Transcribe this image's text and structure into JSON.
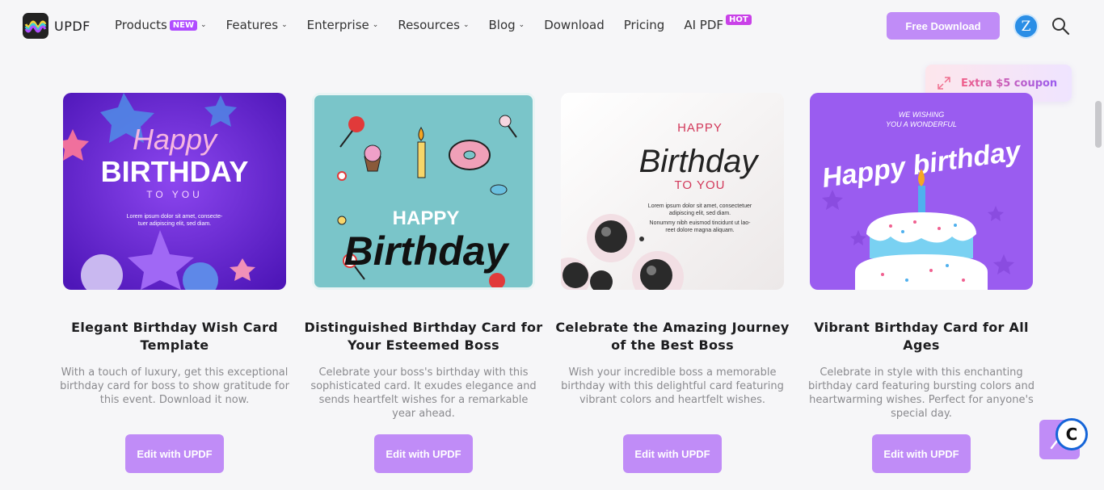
{
  "brand": {
    "name": "UPDF"
  },
  "nav": {
    "items": [
      {
        "label": "Products",
        "badge": "NEW",
        "dropdown": true
      },
      {
        "label": "Features",
        "dropdown": true
      },
      {
        "label": "Enterprise",
        "dropdown": true
      },
      {
        "label": "Resources",
        "dropdown": true
      },
      {
        "label": "Blog",
        "dropdown": true
      },
      {
        "label": "Download",
        "dropdown": false
      },
      {
        "label": "Pricing",
        "dropdown": false
      },
      {
        "label": "AI PDF",
        "badge": "HOT",
        "dropdown": false
      }
    ],
    "free_download": "Free Download",
    "avatar_initial": "Z"
  },
  "coupon": {
    "label": "Extra $5 coupon"
  },
  "cards": [
    {
      "title": "Elegant Birthday Wish Card Template",
      "description": "With a touch of luxury, get this exceptional birthday card for boss to show gratitude for this event. Download it now.",
      "button": "Edit with UPDF",
      "image_text": {
        "line1": "Happy",
        "line2": "BIRTHDAY",
        "line3": "TO YOU",
        "body1": "Lorem ipsum dolor sit amet, consecte-",
        "body2": "tuer adipiscing elit, sed diam."
      }
    },
    {
      "title": "Distinguished Birthday Card for Your Esteemed Boss",
      "description": "Celebrate your boss's birthday with this sophisticated card. It exudes elegance and sends heartfelt wishes for a remarkable year ahead.",
      "button": "Edit with UPDF",
      "image_text": {
        "line1": "HAPPY",
        "line2": "Birthday"
      }
    },
    {
      "title": "Celebrate the Amazing Journey of the Best Boss",
      "description": "Wish your incredible boss a memorable birthday with this delightful card featuring vibrant colors and heartfelt wishes.",
      "button": "Edit with UPDF",
      "image_text": {
        "line1": "HAPPY",
        "line2": "Birthday",
        "line3": "TO YOU",
        "body1": "Lorem ipsum dolor sit amet, consectetuer",
        "body2": "adipiscing elit, sed diam.",
        "body3": "Nonummy nibh euismod tincidunt ut lao-",
        "body4": "reet dolore magna aliquam."
      }
    },
    {
      "title": "Vibrant Birthday Card for All Ages",
      "description": "Celebrate in style with this enchanting birthday card featuring bursting colors and heartwarming wishes. Perfect for anyone's special day.",
      "button": "Edit with UPDF",
      "image_text": {
        "line1": "WE WISHING",
        "line2": "YOU A WONDERFUL",
        "line3": "Happy birthday"
      }
    }
  ],
  "colors": {
    "accent": "#c08cf7",
    "badge": "#b04cff",
    "card1_bg": "#6a28d8",
    "card2_bg": "#7ac5c9",
    "card4_bg": "#9a5cf0"
  },
  "icons": [
    "search-icon",
    "expand-icon",
    "chevron-down-icon",
    "chat-icon",
    "logo-icon"
  ]
}
